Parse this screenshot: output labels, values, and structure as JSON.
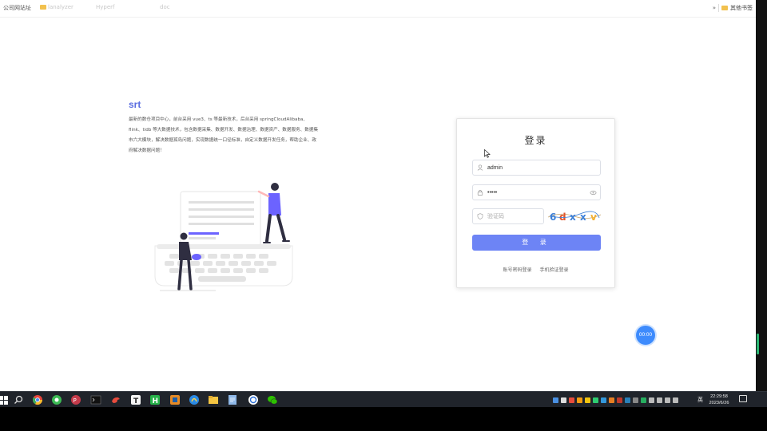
{
  "bookmarks": {
    "items": [
      {
        "label": "公司网站址"
      },
      {
        "label": "lanalyzer"
      },
      {
        "label": "Hyperf"
      },
      {
        "label": "doc"
      }
    ],
    "other_label": "其他书签"
  },
  "intro": {
    "brand": "srt",
    "description": "最新的数仓项目中心，前台采用 vue3、ts 等最新技术，后台采用 springCloudAlibaba、flink、tidb 等大数据技术，包含数据采集、数据开发、数据治理、数据资产、数据服务、数据集市六大模块，解决数据孤岛问题，实现数据统一口径标准，自定义数据开发任务，帮助企业、政府解决数据问题！"
  },
  "login": {
    "title": "登录",
    "username": {
      "value": "admin",
      "icon": "user-icon"
    },
    "password": {
      "value": "•••••",
      "icon": "lock-icon",
      "toggle_icon": "eye-icon"
    },
    "captcha_input": {
      "placeholder": "验证码",
      "icon": "shield-icon"
    },
    "captcha_text": "6dxxv",
    "submit_label": "登 录",
    "alt_links": [
      "账号密码登录",
      "手机验证登录"
    ]
  },
  "timer": {
    "label": "00:00"
  },
  "taskbar": {
    "apps": [
      "windows-logo-icon",
      "search-icon",
      "chrome-icon",
      "green-app-icon",
      "red-app-icon",
      "terminal-icon",
      "red-bird-icon",
      "typora-icon",
      "hbuilder-icon",
      "orange-app-icon",
      "blue-app-icon",
      "file-explorer-icon",
      "notepad-icon",
      "blue-circle-icon",
      "wechat-icon"
    ],
    "ime": "英",
    "time": "22:29:58",
    "date": "2023/6/26"
  },
  "colors": {
    "accent": "#6d84f5",
    "brand": "#5b6ee1",
    "taskbar": "#20242b"
  }
}
